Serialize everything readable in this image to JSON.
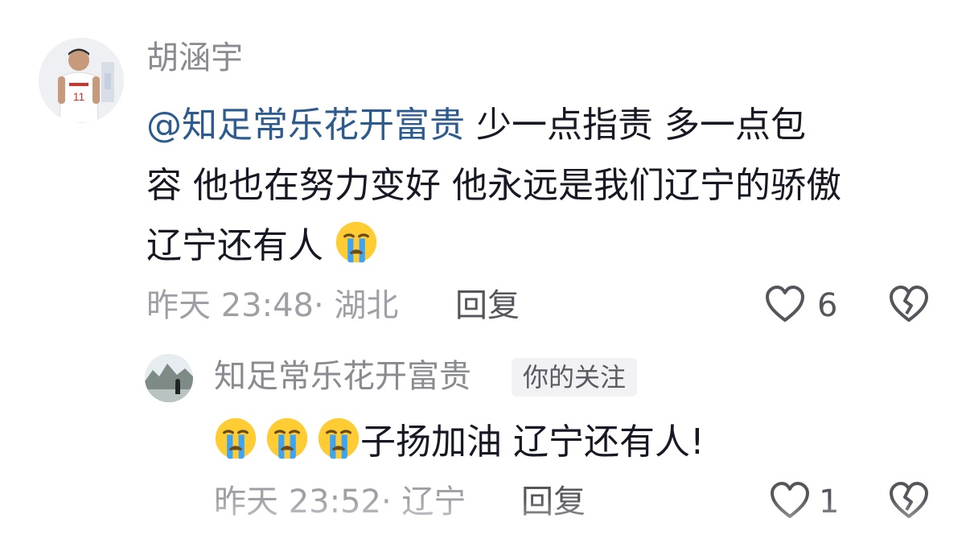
{
  "comment": {
    "username": "胡涵宇",
    "mention": "@知足常乐花开富贵",
    "text_line1_rest": " 少一点指责 多一点包",
    "text_line2": "容 他也在努力变好 他永远是我们辽宁的骄傲",
    "text_line3": "辽宁还有人",
    "meta": "昨天 23:48· 湖北",
    "reply_label": "回复",
    "like_count": "6"
  },
  "reply": {
    "username": "知足常乐花开富贵",
    "badge": "你的关注",
    "text": "子扬加油 辽宁还有人!",
    "meta": "昨天 23:52· 辽宁",
    "reply_label": "回复",
    "like_count": "1"
  },
  "colors": {
    "mention": "#2d5b8f",
    "text": "#161823",
    "muted": "#9ea0a6",
    "emoji_face": "#ffcc33",
    "tear": "#3ea3f2"
  },
  "icons": {
    "emoji": "crying-face-emoji",
    "like": "heart-outline-icon",
    "dislike": "broken-heart-icon"
  }
}
